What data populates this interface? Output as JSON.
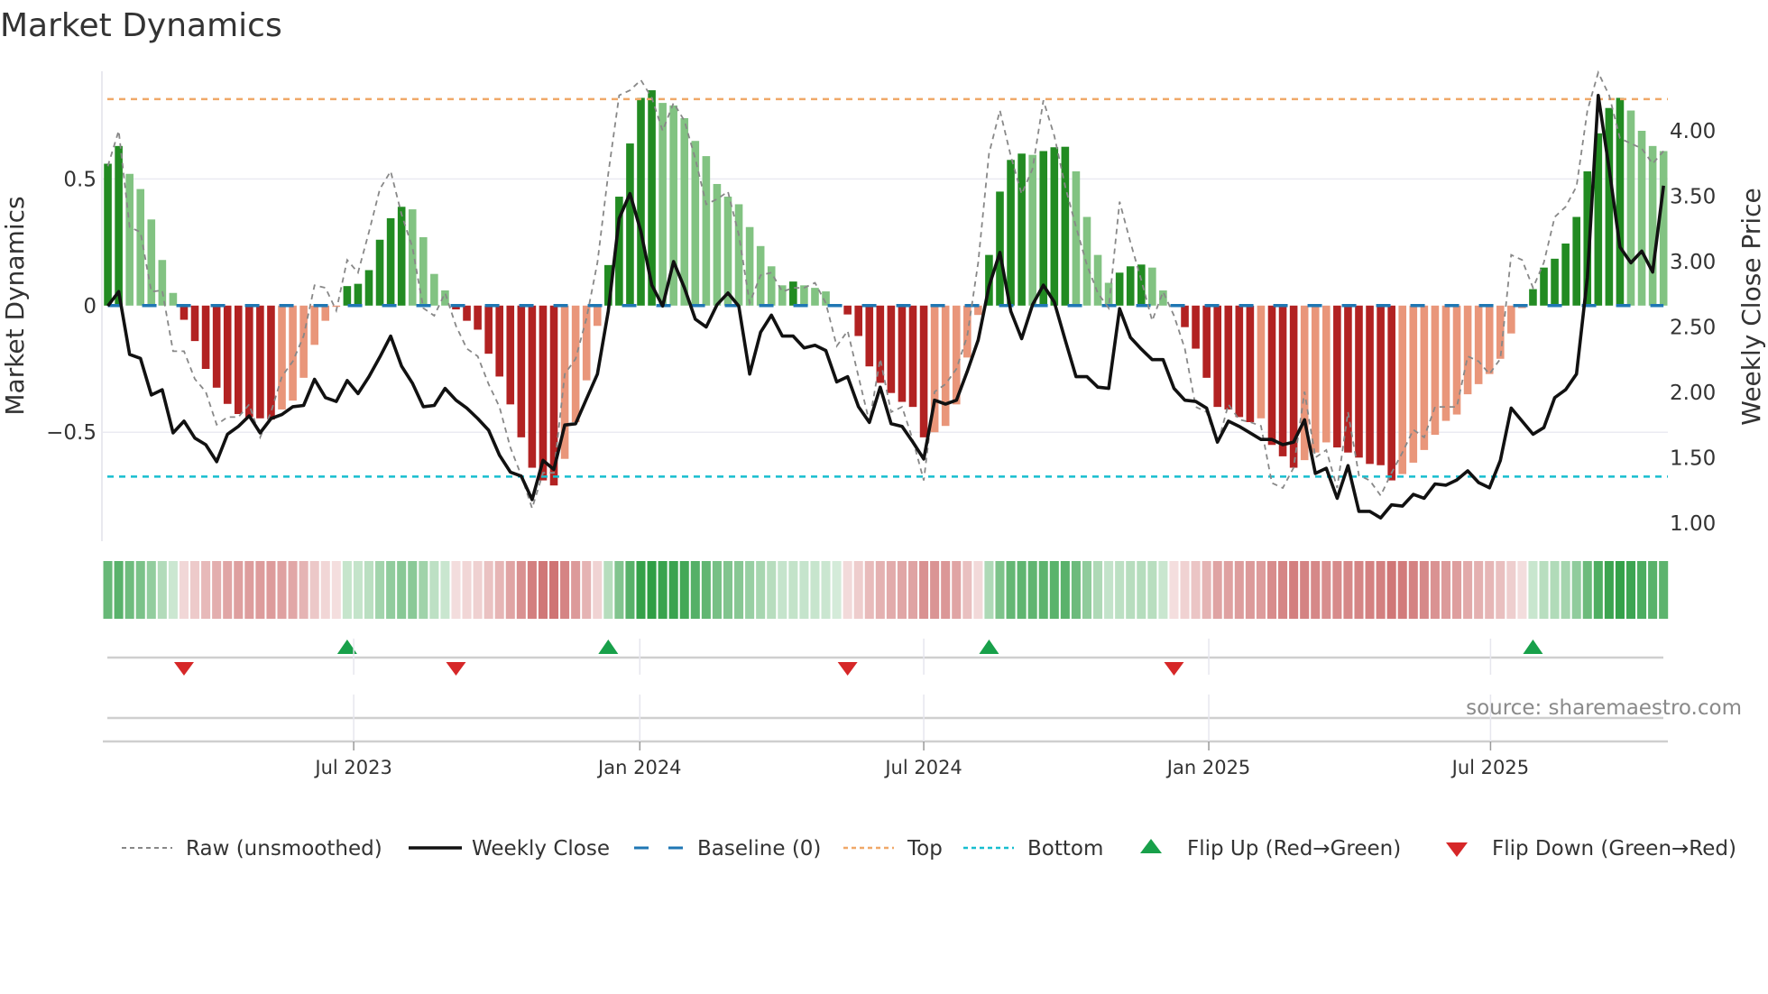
{
  "chart_data": {
    "type": "bar",
    "title": "Market Dynamics",
    "ylabel": "Market Dynamics",
    "y2label": "Weekly Close Price",
    "source": "source: sharemaestro.com",
    "ylim": [
      -0.93,
      0.925
    ],
    "y2lim": [
      0.862,
      4.455
    ],
    "xlim": [
      -0.46,
      143.4
    ],
    "grid": true,
    "legend_position": "bottom",
    "y_ticks": [
      {
        "value": 0.5,
        "label": "0.5"
      },
      {
        "value": 0,
        "label": "0"
      },
      {
        "value": -0.5,
        "label": "−0.5"
      }
    ],
    "y2_ticks": [
      {
        "value": 4.0,
        "label": "4.00"
      },
      {
        "value": 3.5,
        "label": "3.50"
      },
      {
        "value": 3.0,
        "label": "3.00"
      },
      {
        "value": 2.5,
        "label": "2.50"
      },
      {
        "value": 2.0,
        "label": "2.00"
      },
      {
        "value": 1.5,
        "label": "1.50"
      },
      {
        "value": 1.0,
        "label": "1.00"
      }
    ],
    "x_unit": "week index",
    "x_ticks": [
      {
        "at": 22.6,
        "label": "Jul 2023"
      },
      {
        "at": 48.9,
        "label": "Jan 2024"
      },
      {
        "at": 75.0,
        "label": "Jul 2024"
      },
      {
        "at": 101.2,
        "label": "Jan 2025"
      },
      {
        "at": 127.1,
        "label": "Jul 2025"
      }
    ],
    "levels": {
      "top": 0.815,
      "bottom": -0.675,
      "baseline": 0
    },
    "colors": {
      "green_strong": "#228b22",
      "green_fading": "#82c382",
      "red_strong": "#b22222",
      "red_fading": "#e9967a",
      "raw": "#888888",
      "close": "#111111",
      "baseline": "#1f77b4",
      "top": "#f0a868",
      "bottom": "#17becf",
      "flip_up": "#18a04a",
      "flip_down": "#d62728",
      "heat_green": "#2e9e44",
      "heat_red": "#c85f5f"
    },
    "series": [
      {
        "name": "Market Dynamics",
        "kind": "bar",
        "values": [
          0.56,
          0.63,
          0.52,
          0.46,
          0.34,
          0.18,
          0.05,
          -0.056,
          -0.14,
          -0.25,
          -0.324,
          -0.388,
          -0.428,
          -0.44,
          -0.445,
          -0.45,
          -0.41,
          -0.375,
          -0.285,
          -0.155,
          -0.06,
          -0.005,
          0.077,
          0.086,
          0.14,
          0.26,
          0.345,
          0.39,
          0.38,
          0.27,
          0.125,
          0.06,
          -0.015,
          -0.06,
          -0.095,
          -0.19,
          -0.28,
          -0.39,
          -0.52,
          -0.64,
          -0.69,
          -0.71,
          -0.605,
          -0.46,
          -0.295,
          -0.08,
          0.16,
          0.43,
          0.64,
          0.82,
          0.85,
          0.8,
          0.79,
          0.74,
          0.65,
          0.59,
          0.48,
          0.43,
          0.4,
          0.31,
          0.235,
          0.155,
          0.08,
          0.095,
          0.08,
          0.07,
          0.056,
          0.005,
          -0.035,
          -0.12,
          -0.24,
          -0.305,
          -0.345,
          -0.38,
          -0.4,
          -0.52,
          -0.5,
          -0.475,
          -0.39,
          -0.205,
          -0.037,
          0.2,
          0.45,
          0.575,
          0.6,
          0.595,
          0.61,
          0.625,
          0.627,
          0.53,
          0.35,
          0.2,
          0.09,
          0.13,
          0.155,
          0.162,
          0.15,
          0.06,
          -0.005,
          -0.085,
          -0.17,
          -0.285,
          -0.4,
          -0.41,
          -0.44,
          -0.46,
          -0.445,
          -0.55,
          -0.595,
          -0.64,
          -0.61,
          -0.58,
          -0.54,
          -0.56,
          -0.58,
          -0.6,
          -0.625,
          -0.63,
          -0.69,
          -0.665,
          -0.62,
          -0.57,
          -0.51,
          -0.455,
          -0.43,
          -0.35,
          -0.31,
          -0.27,
          -0.21,
          -0.11,
          -0.01,
          0.065,
          0.15,
          0.185,
          0.245,
          0.35,
          0.53,
          0.68,
          0.78,
          0.82,
          0.77,
          0.69,
          0.63,
          0.61
        ]
      },
      {
        "name": "Raw (unsmoothed)",
        "kind": "line",
        "values": [
          0.55,
          0.69,
          0.31,
          0.29,
          0.055,
          0.06,
          -0.18,
          -0.18,
          -0.29,
          -0.34,
          -0.47,
          -0.44,
          -0.44,
          -0.39,
          -0.52,
          -0.42,
          -0.28,
          -0.22,
          -0.12,
          0.08,
          0.07,
          -0.02,
          0.18,
          0.13,
          0.29,
          0.46,
          0.53,
          0.36,
          0.23,
          -0.01,
          -0.04,
          0.05,
          -0.08,
          -0.17,
          -0.2,
          -0.31,
          -0.4,
          -0.56,
          -0.67,
          -0.8,
          -0.66,
          -0.66,
          -0.27,
          -0.21,
          -0.05,
          0.17,
          0.52,
          0.83,
          0.85,
          0.89,
          0.82,
          0.69,
          0.8,
          0.73,
          0.58,
          0.4,
          0.42,
          0.45,
          0.28,
          0.01,
          0.12,
          0.13,
          0.055,
          0.07,
          0.07,
          0.09,
          0.01,
          -0.16,
          -0.1,
          -0.28,
          -0.46,
          -0.21,
          -0.42,
          -0.4,
          -0.53,
          -0.69,
          -0.34,
          -0.31,
          -0.25,
          -0.12,
          0.17,
          0.6,
          0.77,
          0.59,
          0.44,
          0.54,
          0.81,
          0.67,
          0.47,
          0.31,
          0.16,
          0.05,
          -0.01,
          0.41,
          0.25,
          0.1,
          -0.06,
          0.055,
          -0.04,
          -0.17,
          -0.4,
          -0.42,
          -0.55,
          -0.39,
          -0.45,
          -0.46,
          -0.475,
          -0.7,
          -0.72,
          -0.64,
          -0.34,
          -0.6,
          -0.57,
          -0.72,
          -0.42,
          -0.67,
          -0.69,
          -0.75,
          -0.66,
          -0.58,
          -0.49,
          -0.52,
          -0.4,
          -0.4,
          -0.4,
          -0.2,
          -0.22,
          -0.27,
          -0.21,
          0.2,
          0.18,
          0.07,
          0.17,
          0.35,
          0.39,
          0.47,
          0.77,
          0.92,
          0.83,
          0.66,
          0.64,
          0.62,
          0.56,
          0.61
        ]
      },
      {
        "name": "Weekly Close",
        "kind": "line",
        "axis": "right",
        "values": [
          2.66,
          2.77,
          2.29,
          2.26,
          1.98,
          2.02,
          1.69,
          1.78,
          1.65,
          1.6,
          1.47,
          1.68,
          1.74,
          1.82,
          1.69,
          1.8,
          1.83,
          1.89,
          1.9,
          2.1,
          1.96,
          1.93,
          2.09,
          1.99,
          2.12,
          2.27,
          2.43,
          2.2,
          2.07,
          1.89,
          1.9,
          2.03,
          1.94,
          1.88,
          1.8,
          1.71,
          1.52,
          1.39,
          1.36,
          1.18,
          1.48,
          1.41,
          1.75,
          1.76,
          1.95,
          2.14,
          2.62,
          3.33,
          3.52,
          3.23,
          2.82,
          2.66,
          3.0,
          2.8,
          2.56,
          2.5,
          2.67,
          2.76,
          2.66,
          2.14,
          2.46,
          2.59,
          2.43,
          2.43,
          2.34,
          2.36,
          2.32,
          2.08,
          2.12,
          1.89,
          1.77,
          2.04,
          1.76,
          1.74,
          1.62,
          1.49,
          1.94,
          1.91,
          1.94,
          2.16,
          2.4,
          2.81,
          3.07,
          2.62,
          2.41,
          2.67,
          2.82,
          2.69,
          2.4,
          2.12,
          2.12,
          2.04,
          2.03,
          2.64,
          2.42,
          2.33,
          2.25,
          2.25,
          2.03,
          1.94,
          1.93,
          1.88,
          1.62,
          1.78,
          1.74,
          1.69,
          1.64,
          1.64,
          1.6,
          1.62,
          1.79,
          1.38,
          1.42,
          1.19,
          1.44,
          1.09,
          1.09,
          1.04,
          1.14,
          1.13,
          1.22,
          1.19,
          1.3,
          1.29,
          1.33,
          1.4,
          1.31,
          1.27,
          1.48,
          1.88,
          1.78,
          1.68,
          1.73,
          1.96,
          2.02,
          2.14,
          2.88,
          4.27,
          3.71,
          3.11,
          2.99,
          3.08,
          2.92,
          3.58
        ]
      }
    ],
    "legend": [
      {
        "key": "raw",
        "label": "Raw (unsmoothed)"
      },
      {
        "key": "close",
        "label": "Weekly Close"
      },
      {
        "key": "baseline",
        "label": "Baseline (0)"
      },
      {
        "key": "top",
        "label": "Top"
      },
      {
        "key": "bottom",
        "label": "Bottom"
      },
      {
        "key": "flip_up",
        "label": "Flip Up (Red→Green)"
      },
      {
        "key": "flip_down",
        "label": "Flip Down (Green→Red)"
      }
    ]
  }
}
